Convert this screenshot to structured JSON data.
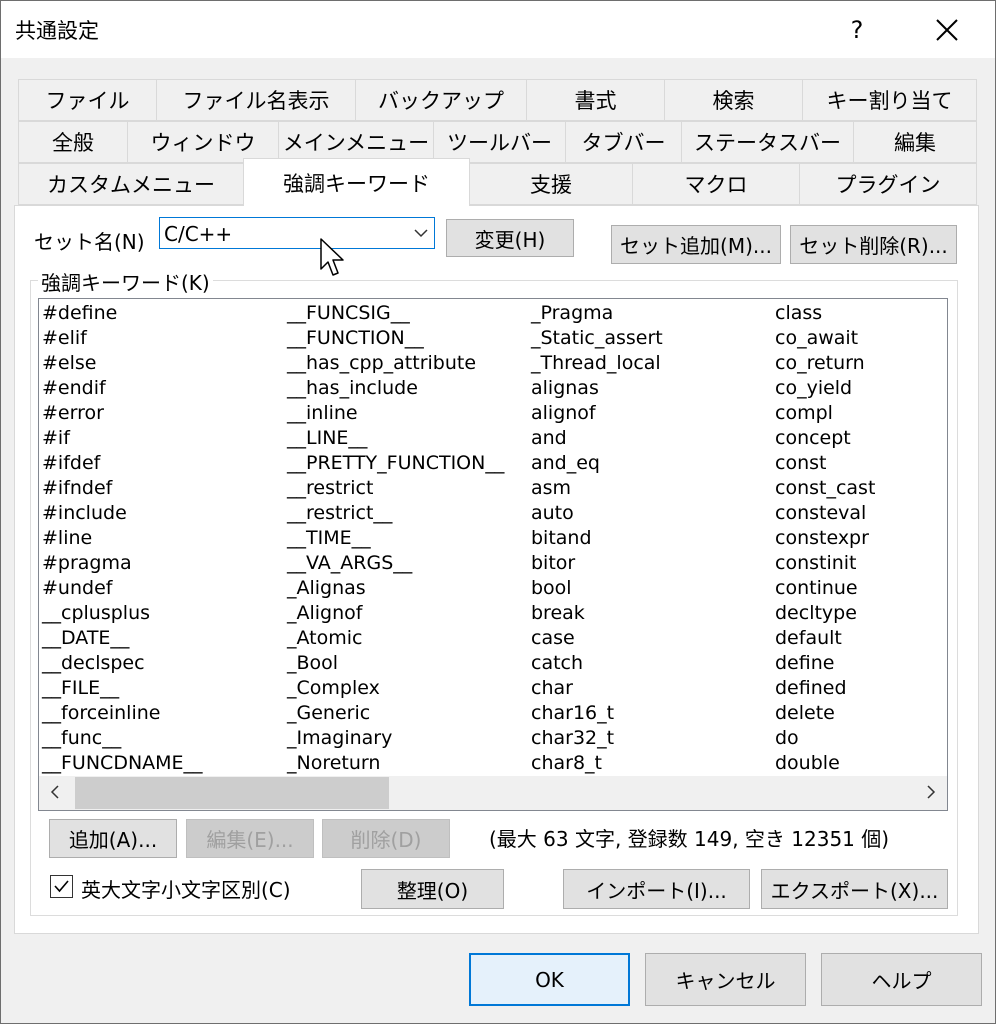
{
  "dialog": {
    "title": "共通設定",
    "help": "?"
  },
  "tabs": {
    "row1": [
      "ファイル",
      "ファイル名表示",
      "バックアップ",
      "書式",
      "検索",
      "キー割り当て"
    ],
    "row2": [
      "全般",
      "ウィンドウ",
      "メインメニュー",
      "ツールバー",
      "タブバー",
      "ステータスバー",
      "編集"
    ],
    "row3": [
      "カスタムメニュー",
      "強調キーワード",
      "支援",
      "マクロ",
      "プラグイン"
    ],
    "active": "強調キーワード"
  },
  "set_name": {
    "label": "セット名(N)",
    "value": "C/C++",
    "change_button": "変更(H)",
    "add_set_button": "セット追加(M)...",
    "delete_set_button": "セット削除(R)..."
  },
  "keywords": {
    "group_title": "強調キーワード(K)",
    "columns": [
      [
        "#define",
        "#elif",
        "#else",
        "#endif",
        "#error",
        "#if",
        "#ifdef",
        "#ifndef",
        "#include",
        "#line",
        "#pragma",
        "#undef",
        "__cplusplus",
        "__DATE__",
        "__declspec",
        "__FILE__",
        "__forceinline",
        "__func__",
        "__FUNCDNAME__"
      ],
      [
        "__FUNCSIG__",
        "__FUNCTION__",
        "__has_cpp_attribute",
        "__has_include",
        "__inline",
        "__LINE__",
        "__PRETTY_FUNCTION__",
        "__restrict",
        "__restrict__",
        "__TIME__",
        "__VA_ARGS__",
        "_Alignas",
        "_Alignof",
        "_Atomic",
        "_Bool",
        "_Complex",
        "_Generic",
        "_Imaginary",
        "_Noreturn"
      ],
      [
        "_Pragma",
        "_Static_assert",
        "_Thread_local",
        "alignas",
        "alignof",
        "and",
        "and_eq",
        "asm",
        "auto",
        "bitand",
        "bitor",
        "bool",
        "break",
        "case",
        "catch",
        "char",
        "char16_t",
        "char32_t",
        "char8_t"
      ],
      [
        "class",
        "co_await",
        "co_return",
        "co_yield",
        "compl",
        "concept",
        "const",
        "const_cast",
        "consteval",
        "constexpr",
        "constinit",
        "continue",
        "decltype",
        "default",
        "define",
        "defined",
        "delete",
        "do",
        "double"
      ]
    ]
  },
  "actions": {
    "add": "追加(A)...",
    "edit": "編集(E)...",
    "delete": "削除(D)",
    "stats": "(最大 63 文字, 登録数 149, 空き 12351 個)",
    "case_label": "英大文字小文字区別(C)",
    "case_checked": true,
    "organize": "整理(O)",
    "import": "インポート(I)...",
    "export": "エクスポート(X)..."
  },
  "footer": {
    "ok": "OK",
    "cancel": "キャンセル",
    "help": "ヘルプ"
  }
}
